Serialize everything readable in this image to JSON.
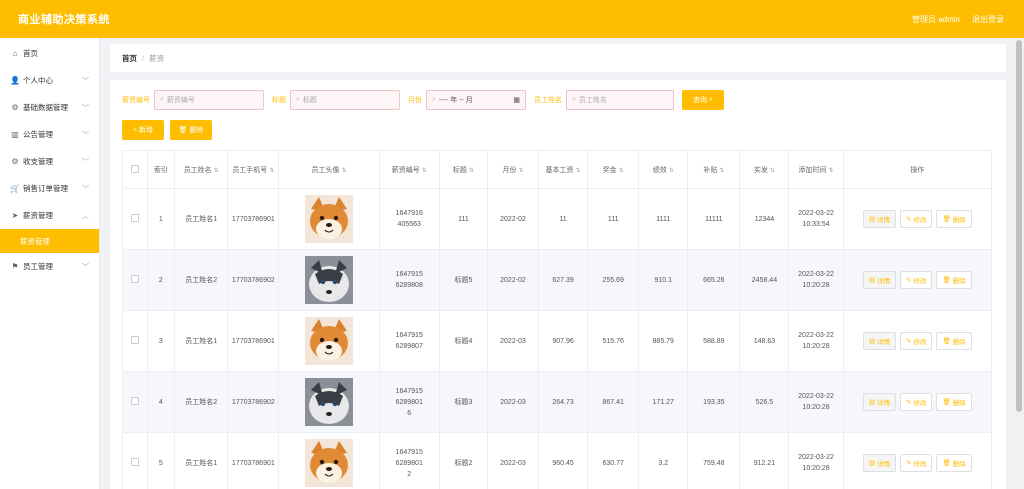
{
  "header": {
    "title": "商业辅助决策系统",
    "user": "管理员 admin",
    "logout": "退出登录"
  },
  "sidebar": {
    "items": [
      {
        "label": "首页",
        "icon": "home-icon",
        "glyph": "⌂",
        "has_children": false
      },
      {
        "label": "个人中心",
        "icon": "user-icon",
        "glyph": "👤",
        "has_children": true
      },
      {
        "label": "基础数据管理",
        "icon": "gear-icon",
        "glyph": "⚙",
        "has_children": true
      },
      {
        "label": "公告管理",
        "icon": "chart-icon",
        "glyph": "▥",
        "has_children": true
      },
      {
        "label": "收支管理",
        "icon": "gear-icon",
        "glyph": "⚙",
        "has_children": true
      },
      {
        "label": "销售订单管理",
        "icon": "cart-icon",
        "glyph": "🛒",
        "has_children": true
      },
      {
        "label": "薪资管理",
        "icon": "send-icon",
        "glyph": "➤",
        "has_children": true,
        "expanded": true
      },
      {
        "label": "员工管理",
        "icon": "flag-icon",
        "glyph": "⚑",
        "has_children": true
      }
    ],
    "sub_item": "薪资管理"
  },
  "breadcrumb": {
    "home": "首页",
    "sep": "/",
    "current": "薪资"
  },
  "search": {
    "salary_no_label": "薪资编号",
    "salary_no_placeholder": "薪资编号",
    "title_label": "标题",
    "title_placeholder": "标题",
    "month_label": "月份",
    "month_placeholder": "---- 年 -- 月",
    "name_label": "员工姓名",
    "name_placeholder": "员工姓名",
    "query": "查询"
  },
  "actions": {
    "add": "+ 新增",
    "delete": "删除"
  },
  "table": {
    "headers": [
      "索引",
      "员工姓名",
      "员工手机号",
      "员工头像",
      "薪资编号",
      "标题",
      "月份",
      "基本工资",
      "奖金",
      "绩效",
      "补贴",
      "实发",
      "添加时间",
      "操作"
    ],
    "ops": {
      "detail": "详情",
      "edit": "修改",
      "delete": "删除"
    },
    "rows": [
      {
        "idx": "1",
        "name": "员工姓名1",
        "phone": "17703786901",
        "avatar": "shiba",
        "no": "1647916405563",
        "title": "111",
        "month": "2022-02",
        "base": "11",
        "bonus": "111",
        "perf": "1111",
        "subsidy": "11111",
        "actual": "12344",
        "time": "2022-03-22 10:33:54"
      },
      {
        "idx": "2",
        "name": "员工姓名2",
        "phone": "17703786902",
        "avatar": "husky",
        "no": "16479156289808",
        "title": "标题5",
        "month": "2022-02",
        "base": "627.39",
        "bonus": "255.69",
        "perf": "910.1",
        "subsidy": "665.26",
        "actual": "2458.44",
        "time": "2022-03-22 10:20:28"
      },
      {
        "idx": "3",
        "name": "员工姓名1",
        "phone": "17703786901",
        "avatar": "shiba",
        "no": "16479156289807",
        "title": "标题4",
        "month": "2022-03",
        "base": "907.96",
        "bonus": "515.76",
        "perf": "885.79",
        "subsidy": "588.89",
        "actual": "148.63",
        "time": "2022-03-22 10:20:28"
      },
      {
        "idx": "4",
        "name": "员工姓名2",
        "phone": "17703786902",
        "avatar": "husky",
        "no": "164791562898016",
        "title": "标题3",
        "month": "2022-03",
        "base": "264.73",
        "bonus": "867.41",
        "perf": "171.27",
        "subsidy": "193.35",
        "actual": "526.5",
        "time": "2022-03-22 10:20:28"
      },
      {
        "idx": "5",
        "name": "员工姓名1",
        "phone": "17703786901",
        "avatar": "shiba",
        "no": "164791562898012",
        "title": "标题2",
        "month": "2022-03",
        "base": "960.45",
        "bonus": "630.77",
        "perf": "3.2",
        "subsidy": "759.48",
        "actual": "912.21",
        "time": "2022-03-22 10:20:28"
      }
    ]
  },
  "colors": {
    "accent": "#ffbd00",
    "input_border": "#f0c3c8"
  }
}
